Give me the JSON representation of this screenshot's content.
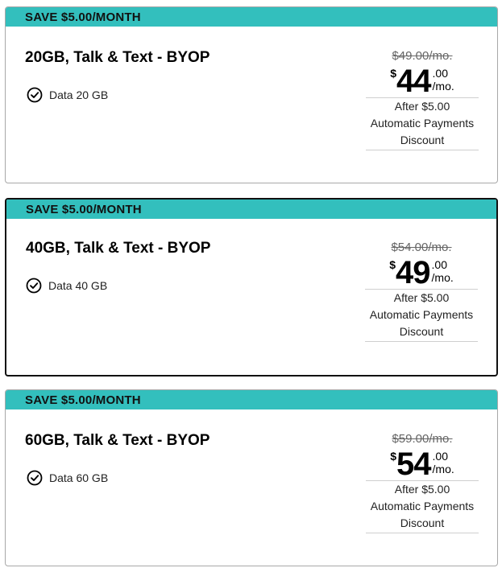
{
  "plans": [
    {
      "save_label": "SAVE $5.00/MONTH",
      "title": "20GB, Talk & Text - BYOP",
      "feature": "Data 20 GB",
      "old_price": "$49.00/mo.",
      "currency": "$",
      "dollars": "44",
      "cents": ".00",
      "per": "/mo.",
      "discount_line1": "After $5.00",
      "discount_line2": "Automatic Payments",
      "discount_line3": "Discount",
      "selected": false
    },
    {
      "save_label": "SAVE $5.00/MONTH",
      "title": "40GB, Talk & Text - BYOP",
      "feature": "Data 40 GB",
      "old_price": "$54.00/mo.",
      "currency": "$",
      "dollars": "49",
      "cents": ".00",
      "per": "/mo.",
      "discount_line1": "After $5.00",
      "discount_line2": "Automatic Payments",
      "discount_line3": "Discount",
      "selected": true
    },
    {
      "save_label": "SAVE $5.00/MONTH",
      "title": "60GB, Talk & Text - BYOP",
      "feature": "Data 60 GB",
      "old_price": "$59.00/mo.",
      "currency": "$",
      "dollars": "54",
      "cents": ".00",
      "per": "/mo.",
      "discount_line1": "After $5.00",
      "discount_line2": "Automatic Payments",
      "discount_line3": "Discount",
      "selected": false
    }
  ],
  "colors": {
    "banner": "#33bfbd",
    "border": "#a8a8a8",
    "selected_border": "#111111"
  },
  "icons": {
    "feature": "check-circle-icon"
  }
}
